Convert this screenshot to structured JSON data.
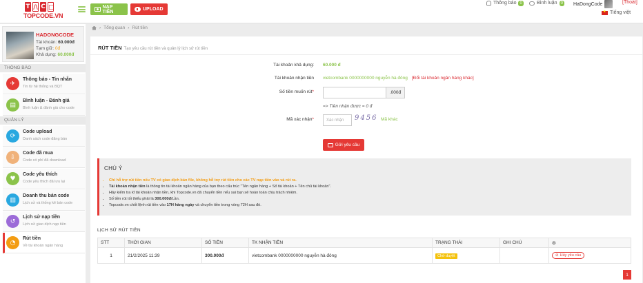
{
  "header": {
    "logo_text": "TOPCODE.VN",
    "nap_tien_label": "NẠP TIỀN",
    "upload_label": "UPLOAD",
    "notif_label": "Thông báo",
    "notif_count": "0",
    "comment_label": "Bình luận",
    "comment_count": "0",
    "username": "HaDongCode",
    "logout_label": "[Thoát]",
    "lang_label": "Tiếng việt"
  },
  "profile": {
    "name": "HADONGCODE",
    "tk_label": "Tài khoản:",
    "tk_value": "60.000đ",
    "tg_label": "Tạm giữ:",
    "tg_value": "0đ",
    "kd_label": "Khả dụng:",
    "kd_value": "60.000đ"
  },
  "sidebar": {
    "section_notice": "THÔNG BÁO",
    "section_manage": "QUẢN LÝ",
    "items": [
      {
        "title": "Thông báo - Tin nhắn",
        "sub": "Tin từ hệ thống và BQT"
      },
      {
        "title": "Bình luận - Đánh giá",
        "sub": "Bình luận & đánh giá cho code"
      },
      {
        "title": "Code upload",
        "sub": "Danh sách code đăng bán"
      },
      {
        "title": "Code đã mua",
        "sub": "Code có phí đã download"
      },
      {
        "title": "Code yêu thích",
        "sub": "Code yêu thích đã lưu lại"
      },
      {
        "title": "Doanh thu bán code",
        "sub": "Lịch sử và thống kê bán code"
      },
      {
        "title": "Lịch sử nạp tiền",
        "sub": "Lịch sử giao dịch nạp tiền"
      },
      {
        "title": "Rút tiền",
        "sub": "Về tài khoản ngân hàng"
      }
    ]
  },
  "breadcrumb": {
    "b1": "Tổng quan",
    "b2": "Rút tiền"
  },
  "withdraw": {
    "title": "RÚT TIỀN",
    "subtitle": "Tạo yêu cầu rút tiền và quản lý lịch sử rút tiền",
    "available_label": "Tài khoản khả dụng:",
    "available_value": "60.000 đ",
    "receive_label": "Tài khoản nhận tiền",
    "receive_value": "vietcombank 0000000000 nguyễn hà đông",
    "change_link": "[Đổi tài khoản ngân hàng khác]",
    "amount_label": "Số tiền muốn rút",
    "amount_suffix": ".000đ",
    "amount_value": "",
    "receive_estimate": "=> Tiền nhận được = 0 đ",
    "captcha_label": "Mã xác nhận",
    "captcha_placeholder": "Xác nhận",
    "captcha_text": "9456",
    "captcha_refresh": "Mã khác",
    "submit_label": "Gửi yêu cầu"
  },
  "notice": {
    "title": "CHÚ Ý",
    "line1": "Chỉ hỗ trợ rút tiền nếu TV có giao dịch bán file, không hỗ trợ rút tiền cho các TV nạp tiền vào và rút ra.",
    "line2_bold": "Tài khoản nhận tiền",
    "line2_rest": " là thông tin tài khoản ngân hàng của bạn theo cấu trúc \"Tên ngân hàng + Số tài khoản + Tên chủ tài khoản\".",
    "line3": "Hãy kiểm tra kĩ tài khoản nhận tiền, khi Topcode.vn đã chuyển tiền nếu sai bạn sẽ hoàn toàn chịu trách nhiệm.",
    "line4_a": "Số tiền rút tối thiểu phải là ",
    "line4_bold": "300.000đ",
    "line4_b": "/Lần.",
    "line5_a": "Topcode.vn chốt lệnh rút tiền vào ",
    "line5_bold": "17H hàng ngày",
    "line5_b": " và chuyển tiền trong vòng 72H sau đó."
  },
  "history": {
    "title": "LỊCH SỬ RÚT TIỀN",
    "headers": [
      "STT",
      "THỜI GIAN",
      "SỐ TIỀN",
      "TK NHẬN TIỀN",
      "TRẠNG THÁI",
      "GHI CHÚ"
    ],
    "rows": [
      {
        "stt": "1",
        "time": "21/2/2025 11:39",
        "amount": "300.000đ",
        "account": "vietcombank 0000000000 nguyễn hà đông",
        "status": "Chờ duyệt",
        "note": "",
        "action": "Hủy yêu cầu"
      }
    ],
    "page": "1"
  },
  "colors": {
    "accent": "#e53935",
    "green": "#8bc34a",
    "status": "#f4c20d"
  }
}
